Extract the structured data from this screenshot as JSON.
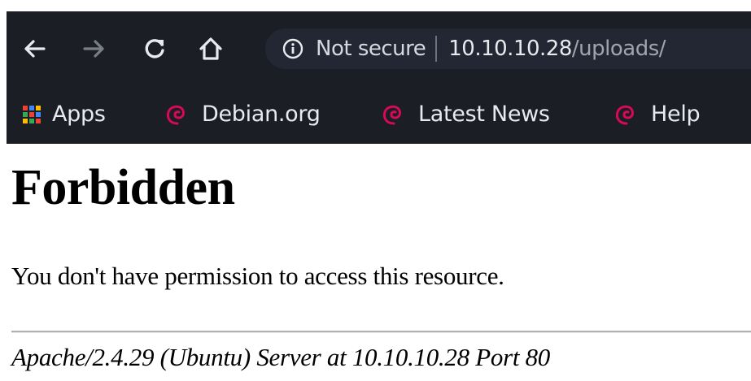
{
  "browser": {
    "nav": {
      "back_icon": "arrow-left-icon",
      "forward_icon": "arrow-right-icon",
      "reload_icon": "reload-icon",
      "home_icon": "home-icon"
    },
    "omnibox": {
      "security_icon": "info-icon",
      "security_label": "Not secure",
      "url_host": "10.10.10.28",
      "url_path": "/uploads/"
    },
    "bookmarks": [
      {
        "label": "Apps",
        "icon": "apps-grid-icon"
      },
      {
        "label": "Debian.org",
        "icon": "debian-swirl-icon"
      },
      {
        "label": "Latest News",
        "icon": "debian-swirl-icon"
      },
      {
        "label": "Help",
        "icon": "debian-swirl-icon"
      }
    ],
    "colors": {
      "toolbar_bg": "#1c1e26",
      "debian_red": "#d70a53"
    }
  },
  "page": {
    "title": "Forbidden",
    "message": "You don't have permission to access this resource.",
    "server_signature": "Apache/2.4.29 (Ubuntu) Server at 10.10.10.28 Port 80"
  }
}
